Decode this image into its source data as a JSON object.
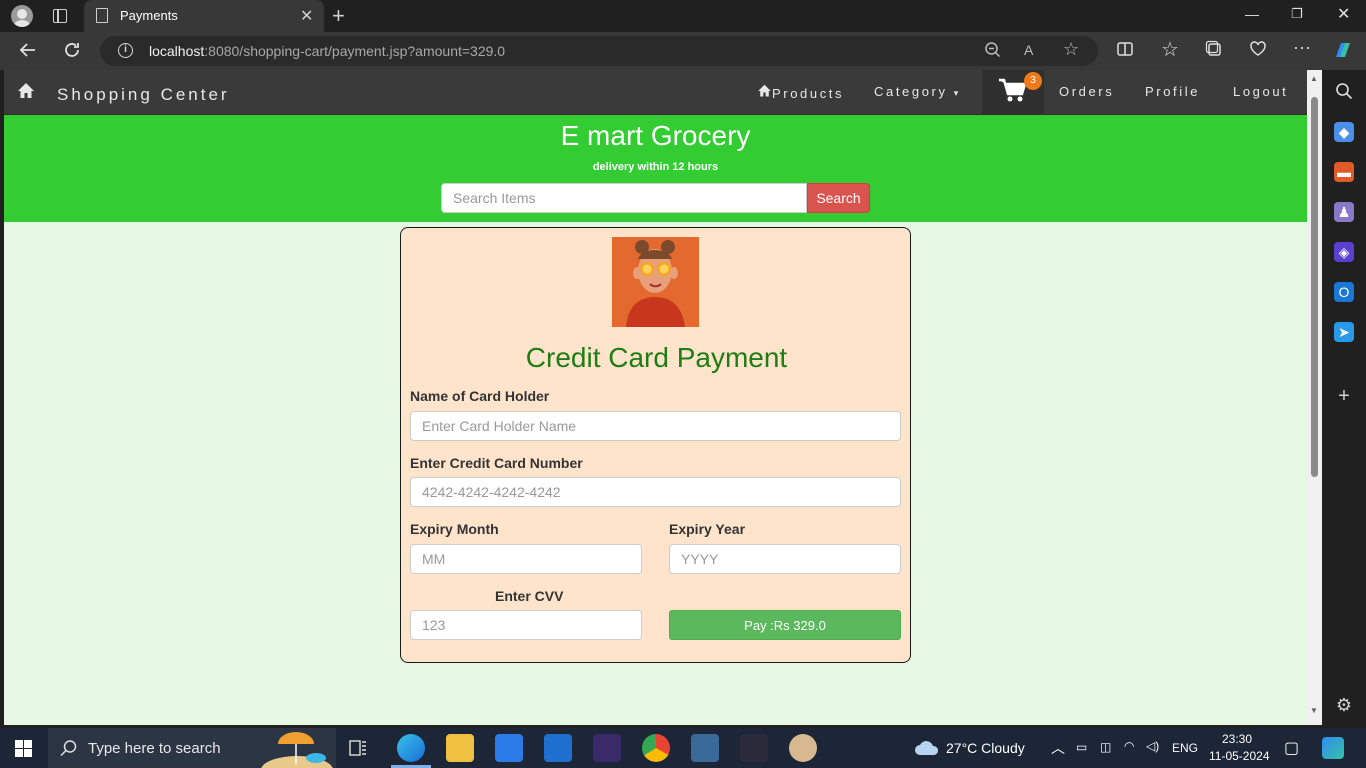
{
  "browser": {
    "tab_title": "Payments",
    "url_host": "localhost",
    "url_rest": ":8080/shopping-cart/payment.jsp?amount=329.0"
  },
  "site": {
    "brand": "Shopping Center",
    "menu": {
      "products": "Products",
      "category": "Category",
      "cart_count": "3",
      "orders": "Orders",
      "profile": "Profile",
      "logout": "Logout"
    },
    "hero_title": "E mart Grocery",
    "hero_subtitle": "delivery within 12 hours",
    "search_placeholder": "Search Items",
    "search_button": "Search"
  },
  "payment": {
    "title": "Credit Card Payment",
    "name_label": "Name of Card Holder",
    "name_placeholder": "Enter Card Holder Name",
    "card_label": "Enter Credit Card Number",
    "card_placeholder": "4242-4242-4242-4242",
    "month_label": "Expiry Month",
    "month_placeholder": "MM",
    "year_label": "Expiry Year",
    "year_placeholder": "YYYY",
    "cvv_label": "Enter CVV",
    "cvv_placeholder": "123",
    "pay_button": "Pay :Rs 329.0"
  },
  "taskbar": {
    "search_text": "Type here to search",
    "weather": "27°C  Cloudy",
    "lang": "ENG",
    "time": "23:30",
    "date": "11-05-2024"
  },
  "colors": {
    "hero": "#33cc33",
    "card_bg": "#ffe4cc",
    "page_bg": "#e6f7e4",
    "title_green": "#1e7d14",
    "pay_button": "#5cb85c",
    "search_button": "#d9534f",
    "cart_badge": "#f07a1a"
  }
}
